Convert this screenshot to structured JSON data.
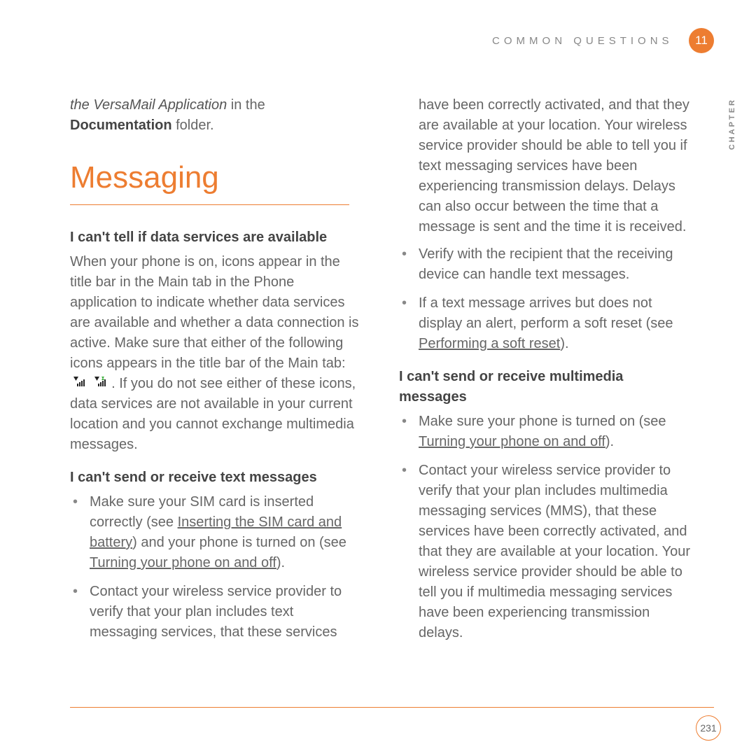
{
  "header": {
    "title": "COMMON QUESTIONS",
    "chapter_number": "11",
    "side_label": "CHAPTER"
  },
  "left": {
    "intro_italic": "the VersaMail Application",
    "intro_mid": " in the ",
    "intro_bold": "Documentation",
    "intro_end": " folder.",
    "section_heading": "Messaging",
    "sub1": "I can't tell if data services are available",
    "para1a": "When your phone is on, icons appear in the title bar in the Main tab in the Phone application to indicate whether data services are available and whether a data connection is active. Make sure that either of the following icons appears in the title bar of the Main tab: ",
    "para1b": ". If you do not see either of these icons, data services are not available in your current location and you cannot exchange multimedia messages.",
    "sub2": "I can't send or receive text messages",
    "b1_a": "Make sure your SIM card is inserted correctly (see ",
    "b1_link": "Inserting the SIM card and battery",
    "b1_b": ") and your phone is turned on (see ",
    "b1_link2": "Turning your phone on and off",
    "b1_c": ").",
    "b2": "Contact your wireless service provider to verify that your plan includes text messaging services, that these services"
  },
  "right": {
    "cont": "have been correctly activated, and that they are available at your location. Your wireless service provider should be able to tell you if text messaging services have been experiencing transmission delays. Delays can also occur between the time that a message is sent and the time it is received.",
    "rb2": "Verify with the recipient that the receiving device can handle text messages.",
    "rb3_a": "If a text message arrives but does not display an alert, perform a soft reset (see ",
    "rb3_link": "Performing a soft reset",
    "rb3_b": ").",
    "sub3": "I can't send or receive multimedia messages",
    "mb1_a": "Make sure your phone is turned on (see ",
    "mb1_link": "Turning your phone on and off",
    "mb1_b": ").",
    "mb2": "Contact your wireless service provider to verify that your plan includes multimedia messaging services (MMS), that these services have been correctly activated, and that they are available at your location. Your wireless service provider should be able to tell you if multimedia messaging services have been experiencing transmission delays."
  },
  "footer": {
    "page": "231"
  }
}
